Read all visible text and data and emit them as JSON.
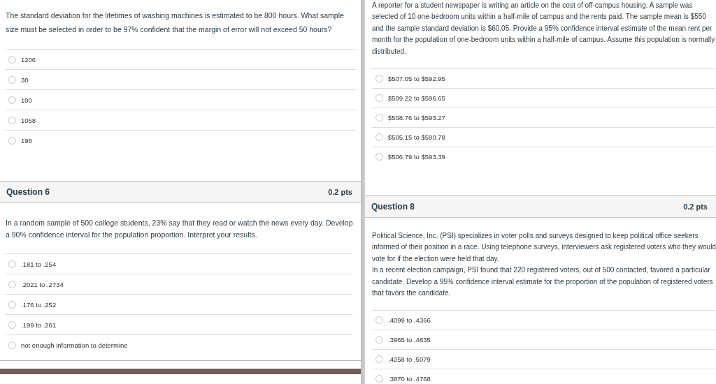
{
  "left": {
    "intro_question": {
      "text": "The standard deviation for the lifetimes of washing machines is estimated to be 800 hours. What sample size must be selected in order to be 97% confident that the margin of error will not exceed 50 hours?",
      "options": [
        {
          "label": "1206",
          "selected": false
        },
        {
          "label": "30",
          "selected": false
        },
        {
          "label": "100",
          "selected": false
        },
        {
          "label": "1058",
          "selected": false
        },
        {
          "label": "198",
          "selected": false
        }
      ]
    },
    "question": {
      "title": "Question 6",
      "points": "0.2 pts",
      "paragraphs": [
        "In a random sample of 500 college students, 23% say that they read or watch the news every day. Develop a 90% confidence interval for the population proportion. Interpret your results."
      ],
      "options": [
        {
          "label": ".181 to .254",
          "selected": false
        },
        {
          "label": ".2021 to .2734",
          "selected": false
        },
        {
          "label": ".176 to .252",
          "selected": false
        },
        {
          "label": ".199 to .261",
          "selected": false
        },
        {
          "label": "not enough information to determine",
          "selected": false
        }
      ]
    }
  },
  "right": {
    "intro_question": {
      "text": "A reporter for a student newspaper is writing an article on the cost of off-campus housing. A sample was selected of 10 one-bedroom units within a half-mile of campus and the rents paid. The sample mean is $550 and the sample standard deviation is $60.05. Provide a 95% confidence interval estimate of the mean rent per month for the population of one-bedroom units within a half-mile of campus. Assume this population is normally distributed.",
      "options": [
        {
          "label": "$507.05 to $592.95",
          "selected": false
        },
        {
          "label": "$509.22 to $596.65",
          "selected": false
        },
        {
          "label": "$508.76 to $593.27",
          "selected": false
        },
        {
          "label": "$505.15 to $590.78",
          "selected": false
        },
        {
          "label": "$506.79 to $593.39",
          "selected": false
        }
      ]
    },
    "question": {
      "title": "Question 8",
      "points": "0.2 pts",
      "paragraphs": [
        "Political Science, Inc. (PSI) specializes in voter polls and surveys designed to keep political office seekers informed of their position in a race. Using telephone surveys, interviewers ask registered voters who they would vote for if the election were held that day.",
        "In a recent election campaign, PSI found that 220 registered voters, out of 500 contacted, favored a particular candidate. Develop a 95% confidence interval estimate for the proportion of the population of registered voters that favors the candidate."
      ],
      "options": [
        {
          "label": ".4099 to .4366",
          "selected": false
        },
        {
          "label": ".3965 to .4835",
          "selected": false
        },
        {
          "label": ".4258 to .5079",
          "selected": false
        },
        {
          "label": ".3870 to .4768",
          "selected": false
        }
      ]
    }
  }
}
